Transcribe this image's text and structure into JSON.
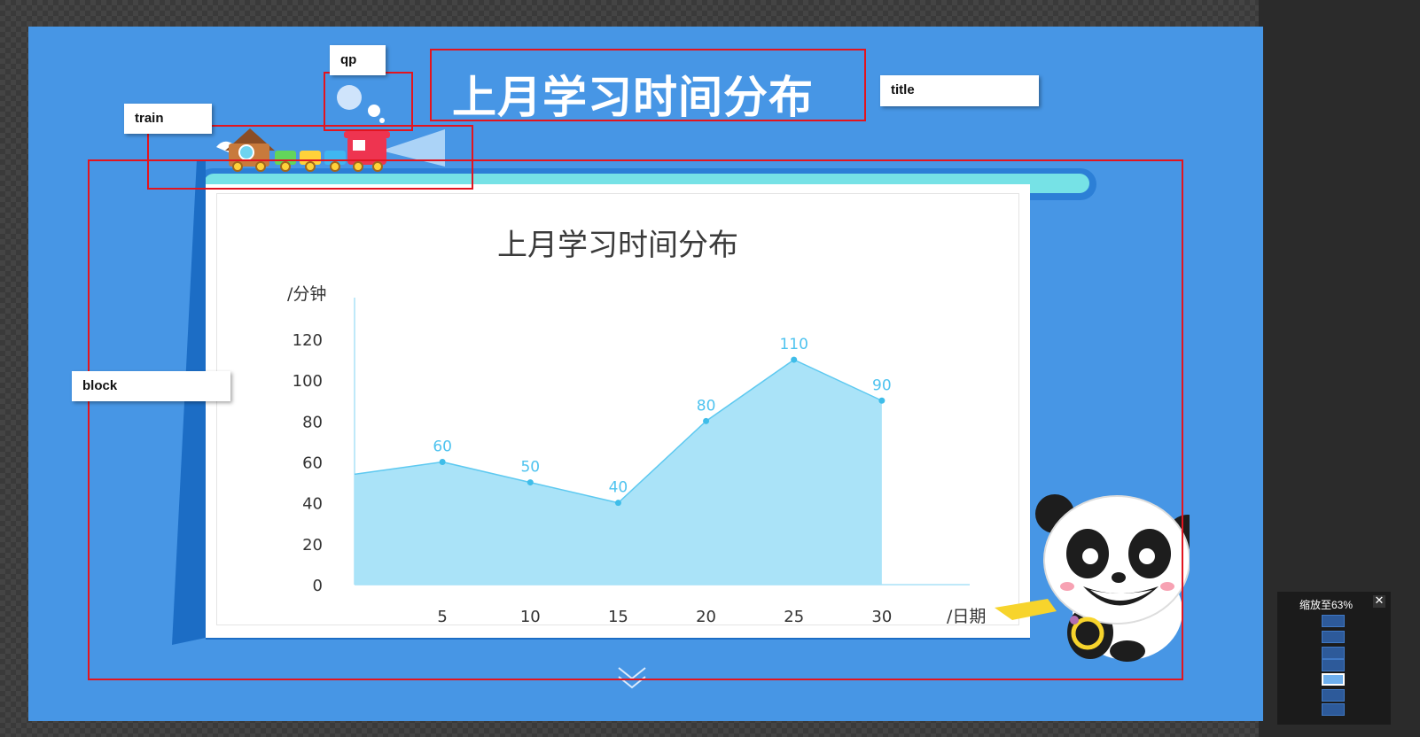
{
  "slide": {
    "heading": "上月学习时间分布"
  },
  "annotations": {
    "qp": "qp",
    "title": "title",
    "train": "train",
    "block": "block"
  },
  "chart_data": {
    "type": "area",
    "title": "上月学习时间分布",
    "ylabel": "/分钟",
    "xlabel": "/日期",
    "ylim": [
      0,
      120
    ],
    "y_ticks": [
      "0",
      "20",
      "40",
      "60",
      "80",
      "100",
      "120"
    ],
    "x_ticks": [
      "5",
      "10",
      "15",
      "20",
      "25",
      "30"
    ],
    "series": [
      {
        "x": [
          0,
          5,
          10,
          15,
          20,
          25,
          30
        ],
        "values": [
          54,
          60,
          50,
          40,
          80,
          110,
          90
        ],
        "labels": [
          "",
          "60",
          "50",
          "40",
          "80",
          "110",
          "90"
        ],
        "color": "#a5e1f8",
        "line_color": "#5ec9f0"
      }
    ],
    "grid": false
  },
  "sidebar": {
    "zoom_label": "缩放至63%",
    "close_symbol": "✕"
  }
}
